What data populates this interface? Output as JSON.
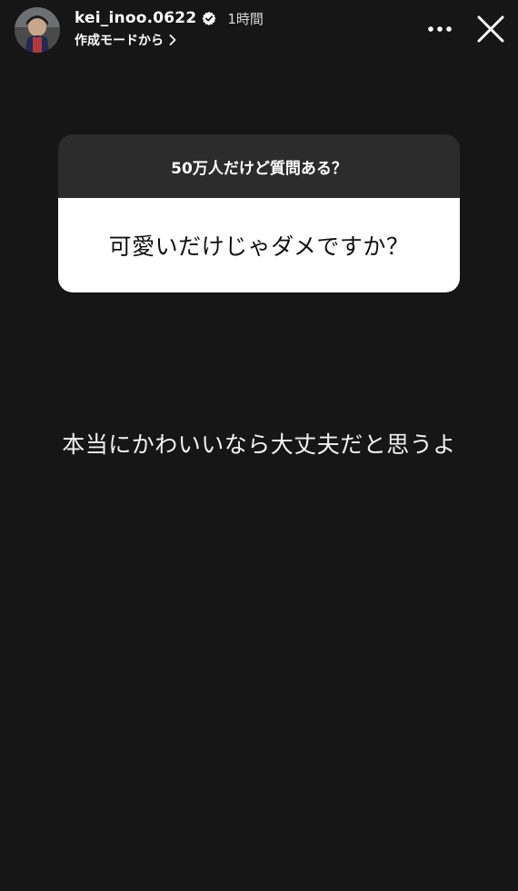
{
  "header": {
    "username": "kei_inoo.0622",
    "time": "1時間",
    "created_with": "作成モードから"
  },
  "question_sticker": {
    "prompt": "50万人だけど質問ある？",
    "question": "可愛いだけじゃダメですか？"
  },
  "answer_text": "本当にかわいいなら大丈夫だと思うよ",
  "colors": {
    "background": "#161616",
    "sticker_header": "#2c2c2c",
    "sticker_body": "#ffffff",
    "text": "#ffffff"
  },
  "icons": [
    "avatar",
    "verified-badge-icon",
    "chevron-right-icon",
    "more-options-icon",
    "close-icon"
  ]
}
